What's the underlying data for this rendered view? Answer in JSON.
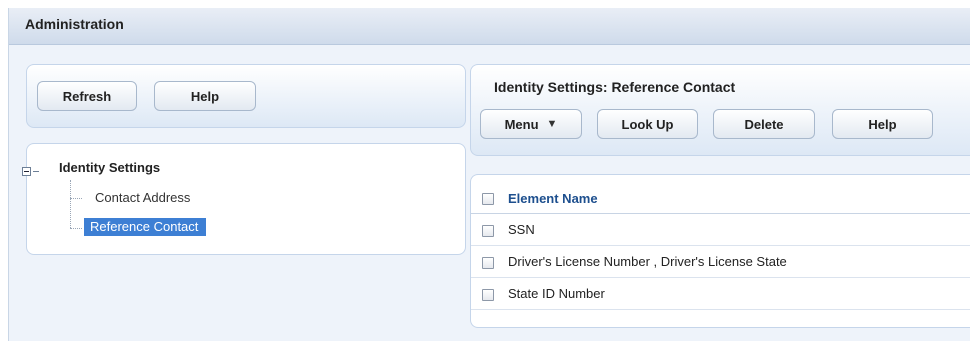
{
  "window": {
    "title": "Administration"
  },
  "left_toolbar": {
    "refresh_label": "Refresh",
    "help_label": "Help"
  },
  "tree": {
    "root_label": "Identity Settings",
    "items": [
      {
        "label": "Contact Address",
        "selected": false
      },
      {
        "label": "Reference Contact",
        "selected": true
      }
    ]
  },
  "right_pane": {
    "title": "Identity Settings: Reference Contact",
    "menu_label": "Menu",
    "lookup_label": "Look Up",
    "delete_label": "Delete",
    "help_label": "Help"
  },
  "table": {
    "column_header": "Element Name",
    "rows": [
      {
        "name": "SSN"
      },
      {
        "name": "Driver's License Number , Driver's License State"
      },
      {
        "name": "State ID Number"
      }
    ]
  },
  "colors": {
    "selection": "#3d7fd4",
    "header_text": "#1d4f8e"
  }
}
